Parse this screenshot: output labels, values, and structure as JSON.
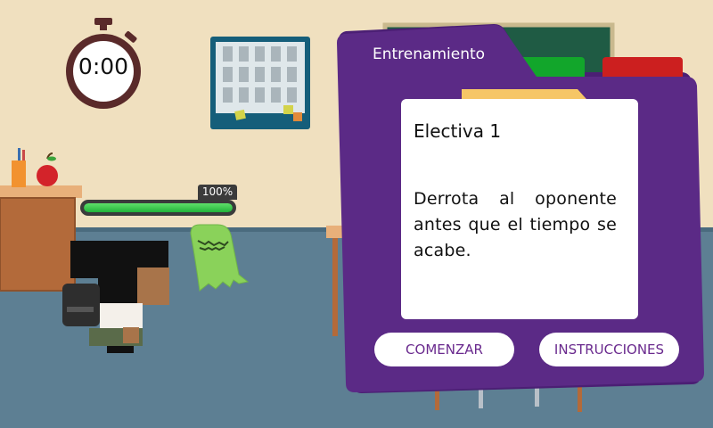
{
  "timer": {
    "label": "0:00"
  },
  "player": {
    "health_label": "100%",
    "health": 1.0
  },
  "panel": {
    "header": "Entrenamiento",
    "card_title": "Electiva 1",
    "card_body": "Derrota al oponente antes que el tiempo se acabe."
  },
  "buttons": {
    "start": "COMENZAR",
    "instructions": "INSTRUCCIONES"
  },
  "colors": {
    "panel_purple": "#5b2a86",
    "accent_yellow": "#f6c667",
    "tab_green": "#12a62b",
    "tab_red": "#cc1f1f",
    "button_text": "#6a2a8e"
  },
  "icons": [
    "stopwatch-icon",
    "calendar-board",
    "apple-icon",
    "pencil-cup",
    "ghost-enemy",
    "player-character"
  ]
}
